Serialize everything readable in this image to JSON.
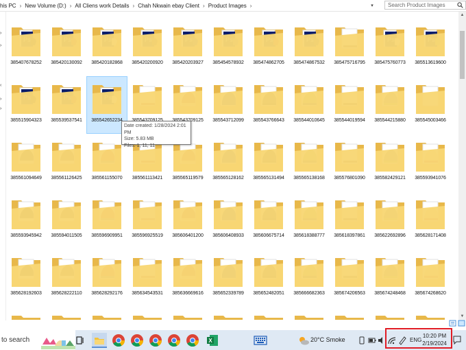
{
  "address_bar": {
    "crumbs": [
      "his PC",
      "New Volume (D:)",
      "All Cliens work Details",
      "Chah Nkwain ebay Client",
      "Product Images"
    ],
    "search_placeholder": "Search Product Images"
  },
  "tooltip": {
    "date_created": "Date created: 1/28/2024 2:01 PM",
    "size": "Size: 5.83 MB",
    "files": "Files: 1, 11, 11"
  },
  "folders": [
    {
      "name": "385407678252",
      "thumb": "ps"
    },
    {
      "name": "385420130092",
      "thumb": "ps"
    },
    {
      "name": "385420182868",
      "thumb": "ps"
    },
    {
      "name": "385420200920",
      "thumb": "ps"
    },
    {
      "name": "385420203927",
      "thumb": "ps"
    },
    {
      "name": "385454578932",
      "thumb": "ps"
    },
    {
      "name": "385474862705",
      "thumb": "ps"
    },
    {
      "name": "385474867532",
      "thumb": "ps"
    },
    {
      "name": "385475716795",
      "thumb": "shoe"
    },
    {
      "name": "385475760773",
      "thumb": "ps"
    },
    {
      "name": "385513619600",
      "thumb": "ps"
    },
    {
      "name": "385515904323",
      "thumb": "ps"
    },
    {
      "name": "385539537541",
      "thumb": "ps"
    },
    {
      "name": "385542652234",
      "thumb": "ps"
    },
    {
      "name": "385543709125",
      "thumb": "shoe"
    },
    {
      "name": "385543709125",
      "thumb": "shoe"
    },
    {
      "name": "385543712099",
      "thumb": "shoe"
    },
    {
      "name": "385543766643",
      "thumb": "shoe"
    },
    {
      "name": "385544010645",
      "thumb": "shoe"
    },
    {
      "name": "385544019594",
      "thumb": "shoe"
    },
    {
      "name": "385544215880",
      "thumb": "shoe"
    },
    {
      "name": "385545003466",
      "thumb": "empty"
    },
    {
      "name": "385561094649",
      "thumb": "shoe"
    },
    {
      "name": "385561126425",
      "thumb": "shoe"
    },
    {
      "name": "385561155070",
      "thumb": "shoe"
    },
    {
      "name": "385561113421",
      "thumb": "shoe"
    },
    {
      "name": "385565119579",
      "thumb": "shoe"
    },
    {
      "name": "385565128162",
      "thumb": "shoe"
    },
    {
      "name": "385565131494",
      "thumb": "shoe"
    },
    {
      "name": "385565138168",
      "thumb": "shoe"
    },
    {
      "name": "385576801090",
      "thumb": "shoe"
    },
    {
      "name": "385582429121",
      "thumb": "shoe"
    },
    {
      "name": "385593941076",
      "thumb": "shoe"
    },
    {
      "name": "385593945942",
      "thumb": "shoe"
    },
    {
      "name": "385594011505",
      "thumb": "shoe"
    },
    {
      "name": "385596909951",
      "thumb": "shoe"
    },
    {
      "name": "385596925519",
      "thumb": "shoe"
    },
    {
      "name": "385606401200",
      "thumb": "shoe"
    },
    {
      "name": "385606408933",
      "thumb": "shoe"
    },
    {
      "name": "385606675714",
      "thumb": "shoe"
    },
    {
      "name": "385618388777",
      "thumb": "shoe"
    },
    {
      "name": "385618397861",
      "thumb": "shoe"
    },
    {
      "name": "385622692896",
      "thumb": "shoe"
    },
    {
      "name": "385628171408",
      "thumb": "shoe"
    },
    {
      "name": "385628192603",
      "thumb": "shoe"
    },
    {
      "name": "385628222110",
      "thumb": "shoe"
    },
    {
      "name": "385628292176",
      "thumb": "shoe"
    },
    {
      "name": "385634543531",
      "thumb": "shoe"
    },
    {
      "name": "385636669616",
      "thumb": "shoe"
    },
    {
      "name": "385652339789",
      "thumb": "shoe"
    },
    {
      "name": "385652482051",
      "thumb": "shoe"
    },
    {
      "name": "385666682363",
      "thumb": "shoe"
    },
    {
      "name": "385674206563",
      "thumb": "shoe"
    },
    {
      "name": "385674248468",
      "thumb": "shoe"
    },
    {
      "name": "385674268620",
      "thumb": "shoe"
    },
    {
      "name": "",
      "thumb": "partial"
    },
    {
      "name": "",
      "thumb": "partial"
    },
    {
      "name": "",
      "thumb": "partial"
    },
    {
      "name": "",
      "thumb": "partial"
    },
    {
      "name": "",
      "thumb": "partial"
    },
    {
      "name": "",
      "thumb": "partial"
    },
    {
      "name": "",
      "thumb": "partial"
    },
    {
      "name": "",
      "thumb": "partial"
    },
    {
      "name": "",
      "thumb": "partial"
    },
    {
      "name": "",
      "thumb": "partial"
    },
    {
      "name": "",
      "thumb": "partial"
    }
  ],
  "selected_index": 13,
  "shoe_palette": [
    "#2b2b2b",
    "#c0392b",
    "#e8e8e8",
    "#6b4a2b",
    "#1f4aa8",
    "#8a8a8a",
    "#d24a1f",
    "#3a3a3a",
    "#e6c9a0",
    "#ffffff",
    "#9bbb3b"
  ],
  "taskbar": {
    "search_text": "to search",
    "weather": "20°C  Smoke",
    "language": "ENG",
    "time": "10:20 PM",
    "date": "2/19/2024"
  },
  "colors": {
    "folder_back": "#e8b84a",
    "folder_front": "#f8d775",
    "selection": "#cce8ff",
    "highlight_box": "#e01b24"
  },
  "icons": [
    "search-icon",
    "folder-icon",
    "photoshop-icon",
    "chrome-icon",
    "excel-icon",
    "file-explorer-icon",
    "task-view-icon",
    "keyboard-icon",
    "weather-icon",
    "wifi-icon",
    "speaker-icon",
    "battery-icon",
    "notification-icon"
  ]
}
